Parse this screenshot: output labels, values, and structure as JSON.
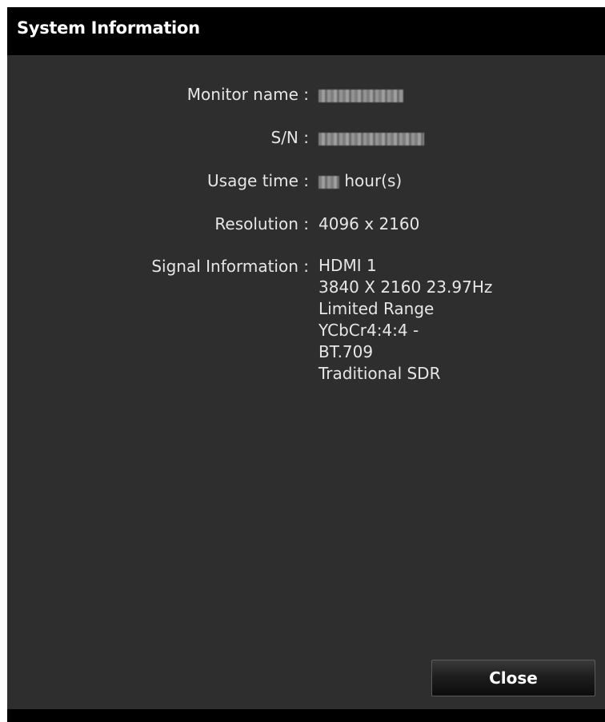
{
  "window": {
    "title": "System Information"
  },
  "info": {
    "monitor_name_label": "Monitor name :",
    "sn_label": "S/N :",
    "usage_time_label": "Usage time :",
    "usage_time_unit": "hour(s)",
    "resolution_label": "Resolution :",
    "resolution_value": "4096 x 2160",
    "signal_label": "Signal Information :",
    "signal_lines": [
      "HDMI 1",
      "3840 X 2160 23.97Hz",
      "Limited Range",
      "YCbCr4:4:4 -",
      "BT.709",
      "Traditional SDR"
    ]
  },
  "buttons": {
    "close_label": "Close"
  }
}
